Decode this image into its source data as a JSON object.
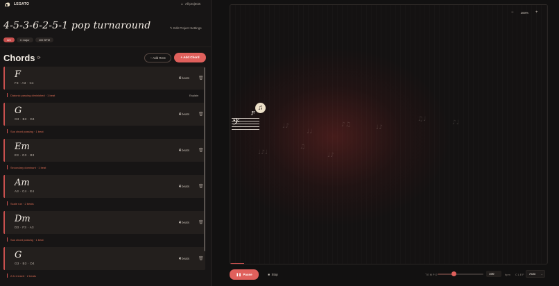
{
  "app": {
    "brand": "LEGATO",
    "all_projects": "All projects"
  },
  "project": {
    "title": "4-5-3-6-2-5-1 pop turnaround",
    "edit_settings": "Edit Project Settings",
    "tags": [
      "4/4",
      "C major",
      "100 BPM"
    ]
  },
  "chords_section": {
    "heading": "Chords",
    "add_rest": "Add Rest",
    "add_chord": "Add Chord"
  },
  "chords": [
    {
      "name": "F",
      "notes": "F3 · A3 · C4",
      "beats": "4",
      "beats_label": "beats",
      "transition": "Diatonic passing diminished · 1 beat",
      "explain": "Explain"
    },
    {
      "name": "G",
      "notes": "G3 · B3 · D4",
      "beats": "4",
      "beats_label": "beats",
      "transition": "Sus chord passing · 1 beat",
      "explain": ""
    },
    {
      "name": "Em",
      "notes": "E3 · G3 · B3",
      "beats": "4",
      "beats_label": "beats",
      "transition": "Secondary dominant · 1 beat",
      "explain": ""
    },
    {
      "name": "Am",
      "notes": "A3 · C4 · E4",
      "beats": "4",
      "beats_label": "beats",
      "transition": "Scale run · 2 beats",
      "explain": ""
    },
    {
      "name": "Dm",
      "notes": "D3 · F3 · A3",
      "beats": "4",
      "beats_label": "beats",
      "transition": "Sus chord passing · 1 beat",
      "explain": ""
    },
    {
      "name": "G",
      "notes": "G3 · B3 · D4",
      "beats": "4",
      "beats_label": "beats",
      "transition": "2-5-1 insert · 2 beats",
      "explain": ""
    }
  ],
  "score": {
    "zoom": "100%",
    "current_chord": "F",
    "icon": "music-note-icon"
  },
  "playback": {
    "pause": "Pause",
    "stop": "Stop",
    "tempo_label": "TEMPO",
    "tempo_value": "100",
    "tempo_fraction": 0.35,
    "bpm_label": "bpm",
    "clef_label": "CLEF",
    "clef_value": "Auto"
  },
  "colors": {
    "accent": "#e0605c",
    "transition_text": "#d86a52",
    "background": "#161414"
  }
}
